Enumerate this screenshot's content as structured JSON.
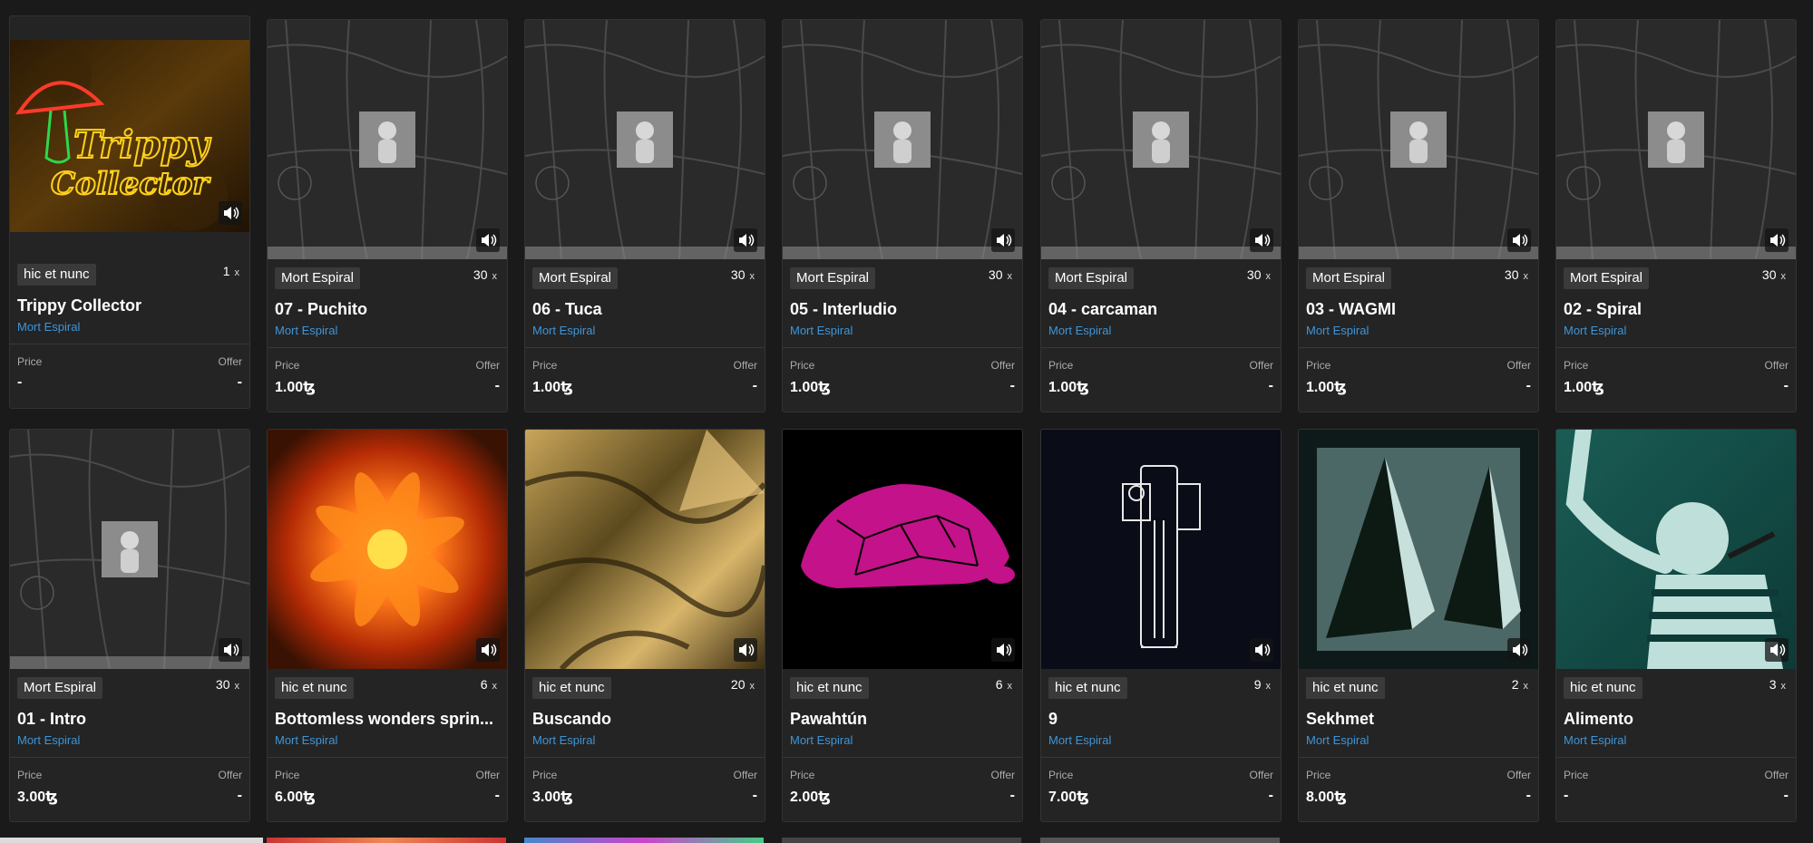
{
  "labels": {
    "price": "Price",
    "offer": "Offer",
    "x": "x"
  },
  "cards": [
    {
      "platform": "hic et nunc",
      "editions": "1",
      "title": "Trippy Collector",
      "artist": "Mort Espiral",
      "price": "-",
      "offer": "-"
    },
    {
      "platform": "Mort Espiral",
      "editions": "30",
      "title": "07 - Puchito",
      "artist": "Mort Espiral",
      "price": "1.00ꜩ",
      "offer": "-"
    },
    {
      "platform": "Mort Espiral",
      "editions": "30",
      "title": "06 - Tuca",
      "artist": "Mort Espiral",
      "price": "1.00ꜩ",
      "offer": "-"
    },
    {
      "platform": "Mort Espiral",
      "editions": "30",
      "title": "05 - Interludio",
      "artist": "Mort Espiral",
      "price": "1.00ꜩ",
      "offer": "-"
    },
    {
      "platform": "Mort Espiral",
      "editions": "30",
      "title": "04 - carcaman",
      "artist": "Mort Espiral",
      "price": "1.00ꜩ",
      "offer": "-"
    },
    {
      "platform": "Mort Espiral",
      "editions": "30",
      "title": "03 - WAGMI",
      "artist": "Mort Espiral",
      "price": "1.00ꜩ",
      "offer": "-"
    },
    {
      "platform": "Mort Espiral",
      "editions": "30",
      "title": "02 - Spiral",
      "artist": "Mort Espiral",
      "price": "1.00ꜩ",
      "offer": "-"
    },
    {
      "platform": "Mort Espiral",
      "editions": "30",
      "title": "01 - Intro",
      "artist": "Mort Espiral",
      "price": "3.00ꜩ",
      "offer": "-"
    },
    {
      "platform": "hic et nunc",
      "editions": "6",
      "title": "Bottomless wonders sprin...",
      "artist": "Mort Espiral",
      "price": "6.00ꜩ",
      "offer": "-"
    },
    {
      "platform": "hic et nunc",
      "editions": "20",
      "title": "Buscando",
      "artist": "Mort Espiral",
      "price": "3.00ꜩ",
      "offer": "-"
    },
    {
      "platform": "hic et nunc",
      "editions": "6",
      "title": "Pawahtún",
      "artist": "Mort Espiral",
      "price": "2.00ꜩ",
      "offer": "-"
    },
    {
      "platform": "hic et nunc",
      "editions": "9",
      "title": "9",
      "artist": "Mort Espiral",
      "price": "7.00ꜩ",
      "offer": "-"
    },
    {
      "platform": "hic et nunc",
      "editions": "2",
      "title": "Sekhmet",
      "artist": "Mort Espiral",
      "price": "8.00ꜩ",
      "offer": "-"
    },
    {
      "platform": "hic et nunc",
      "editions": "3",
      "title": "Alimento",
      "artist": "Mort Espiral",
      "price": "-",
      "offer": "-"
    }
  ],
  "icons": {
    "audio": "speaker-icon"
  },
  "colors": {
    "background": "#1a1a1a",
    "card": "#242424",
    "artist_link": "#3d95d8"
  }
}
